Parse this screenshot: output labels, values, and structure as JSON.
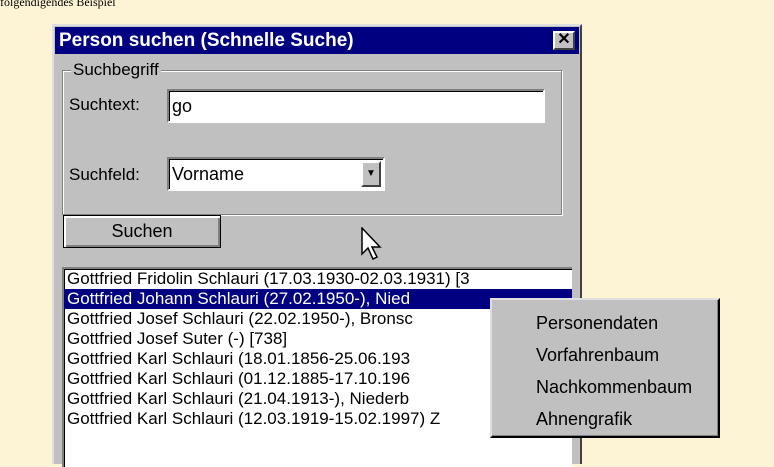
{
  "top_text": "folgendigendes Beispiel",
  "dialog": {
    "title": "Person suchen (Schnelle Suche)",
    "close_symbol": "✕"
  },
  "groupbox": {
    "legend": "Suchbegriff",
    "suchtext_label": "Suchtext:",
    "suchtext_value": "go",
    "suchfeld_label": "Suchfeld:",
    "suchfeld_value": "Vorname"
  },
  "search_button": "Suchen",
  "results": [
    "Gottfried Fridolin Schlauri (17.03.1930-02.03.1931) [3",
    "Gottfried Johann Schlauri (27.02.1950-), Nied",
    "Gottfried Josef Schlauri (22.02.1950-), Bronsc",
    "Gottfried Josef Suter (-) [738]",
    "Gottfried Karl Schlauri (18.01.1856-25.06.193",
    "Gottfried Karl Schlauri (01.12.1885-17.10.196",
    "Gottfried Karl Schlauri (21.04.1913-), Niederb",
    "Gottfried Karl Schlauri (12.03.1919-15.02.1997) Z"
  ],
  "selected_index": 1,
  "context_menu": [
    "Personendaten",
    "Vorfahrenbaum",
    "Nachkommenbaum",
    "Ahnengrafik"
  ],
  "colors": {
    "background": "#fdf4d6",
    "titlebar": "#000080",
    "selection": "#000080",
    "face": "#c0c0c0"
  }
}
